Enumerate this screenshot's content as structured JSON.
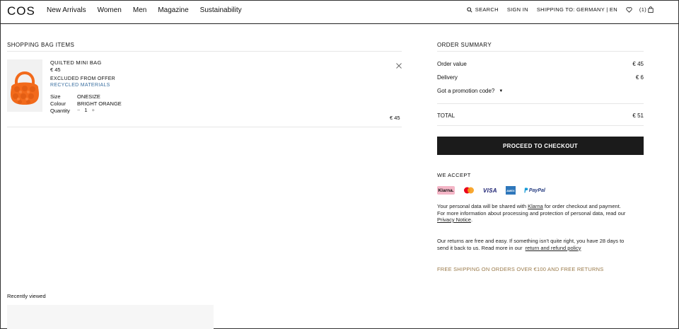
{
  "header": {
    "logo": "COS",
    "nav": [
      "New Arrivals",
      "Women",
      "Men",
      "Magazine",
      "Sustainability"
    ],
    "search_label": "SEARCH",
    "sign_in": "SIGN IN",
    "shipping": "SHIPPING TO: GERMANY | EN",
    "bag_count": "(1)"
  },
  "bag": {
    "title": "SHOPPING BAG ITEMS",
    "item": {
      "name": "QUILTED MINI BAG",
      "price": "€ 45",
      "excluded": "EXCLUDED FROM OFFER",
      "material": "RECYCLED MATERIALS",
      "size_label": "Size",
      "size_value": "ONESIZE",
      "colour_label": "Colour",
      "colour_value": "BRIGHT ORANGE",
      "quantity_label": "Quantity",
      "quantity_minus": "−",
      "quantity_value": "1",
      "quantity_plus": "+",
      "line_total": "€ 45"
    }
  },
  "summary": {
    "title": "ORDER SUMMARY",
    "order_value_label": "Order value",
    "order_value": "€ 45",
    "delivery_label": "Delivery",
    "delivery_value": "€ 6",
    "promo_label": "Got a promotion code?",
    "total_label": "TOTAL",
    "total_value": "€ 51",
    "checkout_label": "PROCEED TO CHECKOUT",
    "we_accept": "WE ACCEPT",
    "payments": {
      "klarna": "Klarna.",
      "visa": "VISA",
      "amex": "AMEX",
      "paypal": "PayPal"
    },
    "privacy": {
      "line1_a": "Your personal data will be shared with ",
      "line1_link": "Klarna",
      "line1_b": " for order checkout and payment.",
      "line2": "For more information about processing and protection of personal data, read our",
      "line3_link": "Privacy Notice",
      "line3_end": "."
    },
    "returns": {
      "line1": "Our returns are free and easy. If something isn't quite right, you have 28 days to",
      "line2_a": "send it back to us. Read more in our  ",
      "line2_link": "return and refund policy"
    },
    "free_shipping": "FREE SHIPPING ON ORDERS OVER €100 AND FREE RETURNS"
  },
  "recently_viewed": "Recently viewed",
  "colors": {
    "product_orange": "#f26a1b",
    "checkout_bg": "#1b1b1b",
    "link_blue": "#3a6fa0",
    "free_shipping": "#9a7a4a"
  }
}
